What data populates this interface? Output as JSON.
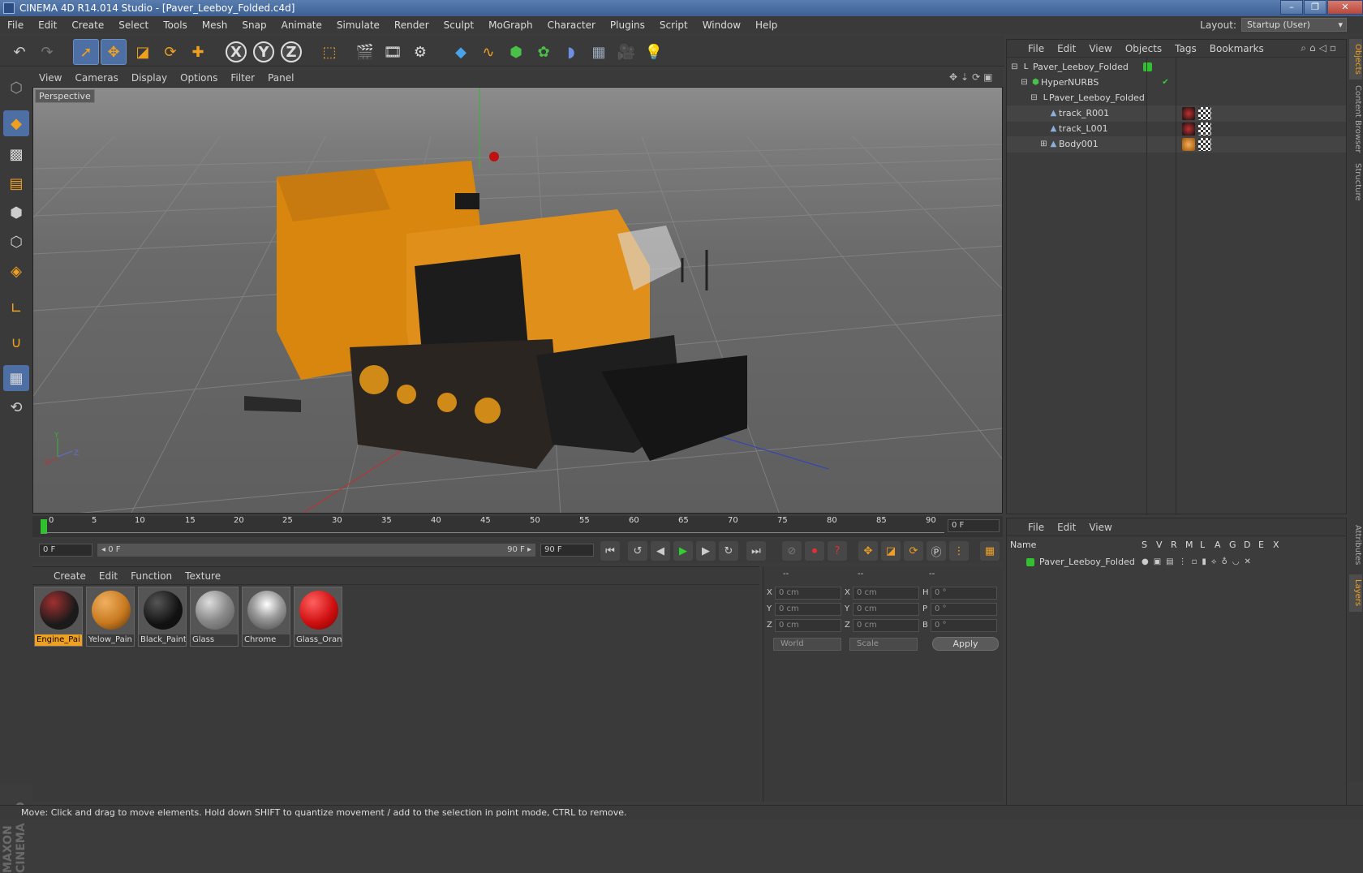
{
  "window": {
    "title": "CINEMA 4D R14.014 Studio - [Paver_Leeboy_Folded.c4d]"
  },
  "menu": [
    "File",
    "Edit",
    "Create",
    "Select",
    "Tools",
    "Mesh",
    "Snap",
    "Animate",
    "Simulate",
    "Render",
    "Sculpt",
    "MoGraph",
    "Character",
    "Plugins",
    "Script",
    "Window",
    "Help"
  ],
  "layout": {
    "label": "Layout:",
    "value": "Startup (User)"
  },
  "toolbar": {
    "axis_x": "X",
    "axis_y": "Y",
    "axis_z": "Z"
  },
  "viewport": {
    "menu": [
      "View",
      "Cameras",
      "Display",
      "Options",
      "Filter",
      "Panel"
    ],
    "label": "Perspective",
    "axis_y": "Y",
    "axis_x": "X",
    "axis_z": "Z"
  },
  "timeline": {
    "ticks": [
      "0",
      "5",
      "10",
      "15",
      "20",
      "25",
      "30",
      "35",
      "40",
      "45",
      "50",
      "55",
      "60",
      "65",
      "70",
      "75",
      "80",
      "85",
      "90"
    ],
    "current_frame": "0 F"
  },
  "transport": {
    "start": "0 F",
    "range_start": "◂ 0 F",
    "range_end": "90 F ▸",
    "end": "90 F"
  },
  "materials": {
    "menu": [
      "Create",
      "Edit",
      "Function",
      "Texture"
    ],
    "items": [
      {
        "name": "Engine_Pai",
        "color": "#1a1a1a",
        "selected": true
      },
      {
        "name": "Yelow_Pain",
        "color": "#c87a20",
        "selected": false
      },
      {
        "name": "Black_Paint",
        "color": "#111111",
        "selected": false
      },
      {
        "name": "Glass",
        "color": "#8a8a8a",
        "selected": false
      },
      {
        "name": "Chrome",
        "color": "#9a9a9a",
        "selected": false
      },
      {
        "name": "Glass_Oran",
        "color": "#d01010",
        "selected": false
      }
    ]
  },
  "coords": {
    "header": [
      "--",
      "--",
      "--"
    ],
    "rows": [
      {
        "l1": "X",
        "v1": "0 cm",
        "l2": "X",
        "v2": "0 cm",
        "l3": "H",
        "v3": "0 °"
      },
      {
        "l1": "Y",
        "v1": "0 cm",
        "l2": "Y",
        "v2": "0 cm",
        "l3": "P",
        "v3": "0 °"
      },
      {
        "l1": "Z",
        "v1": "0 cm",
        "l2": "Z",
        "v2": "0 cm",
        "l3": "B",
        "v3": "0 °"
      }
    ],
    "space": "World",
    "mode": "Scale",
    "apply": "Apply"
  },
  "objects": {
    "menu": [
      "File",
      "Edit",
      "View",
      "Objects",
      "Tags",
      "Bookmarks"
    ],
    "rows": [
      {
        "name": "Paver_Leeboy_Folded",
        "indent": 0
      },
      {
        "name": "HyperNURBS",
        "indent": 1
      },
      {
        "name": "Paver_Leeboy_Folded",
        "indent": 2
      },
      {
        "name": "track_R001",
        "indent": 3
      },
      {
        "name": "track_L001",
        "indent": 3
      },
      {
        "name": "Body001",
        "indent": 3
      }
    ]
  },
  "layers": {
    "menu": [
      "File",
      "Edit",
      "View"
    ],
    "name_header": "Name",
    "cols": [
      "S",
      "V",
      "R",
      "M",
      "L",
      "A",
      "G",
      "D",
      "E",
      "X"
    ],
    "rows": [
      {
        "name": "Paver_Leeboy_Folded",
        "color": "#30c030"
      }
    ]
  },
  "right_tabs": [
    "Objects",
    "Content Browser",
    "Structure",
    "Attributes",
    "Layers"
  ],
  "brand": "MAXON CINEMA 4D",
  "status": "Move: Click and drag to move elements. Hold down SHIFT to quantize movement / add to the selection in point mode, CTRL to remove."
}
